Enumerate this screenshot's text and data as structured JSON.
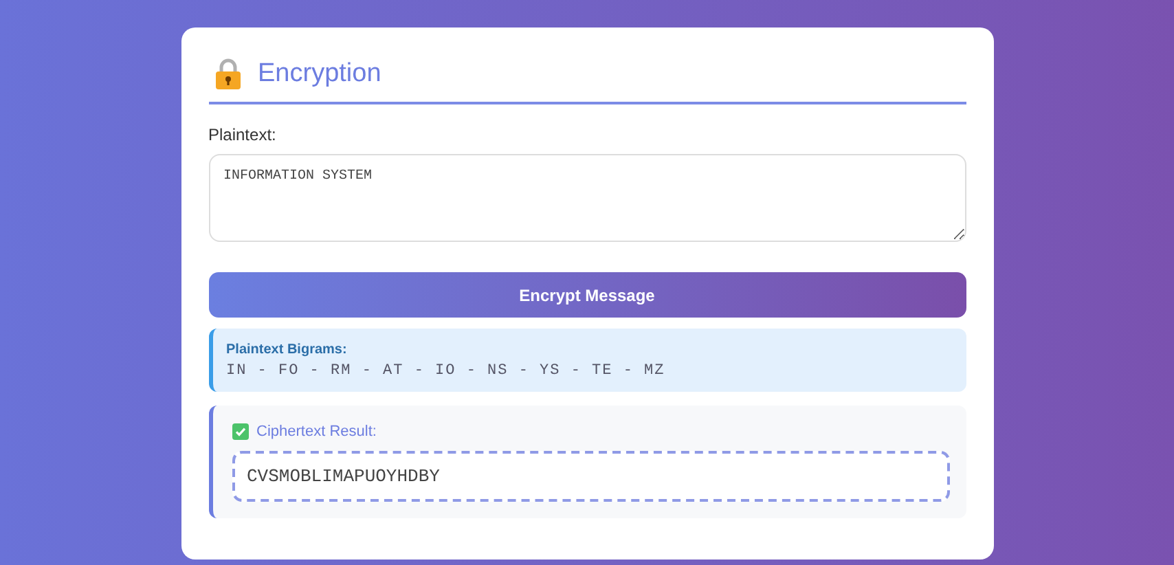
{
  "card": {
    "title": "Encryption"
  },
  "plaintext": {
    "label": "Plaintext:",
    "value": "INFORMATION SYSTEM"
  },
  "encrypt_button": {
    "label": "Encrypt Message"
  },
  "bigrams": {
    "label": "Plaintext Bigrams:",
    "text": "IN - FO - RM - AT - IO - NS - YS - TE - MZ"
  },
  "result": {
    "label": "Ciphertext Result:",
    "value": "CVSMOBLIMAPUOYHDBY"
  }
}
